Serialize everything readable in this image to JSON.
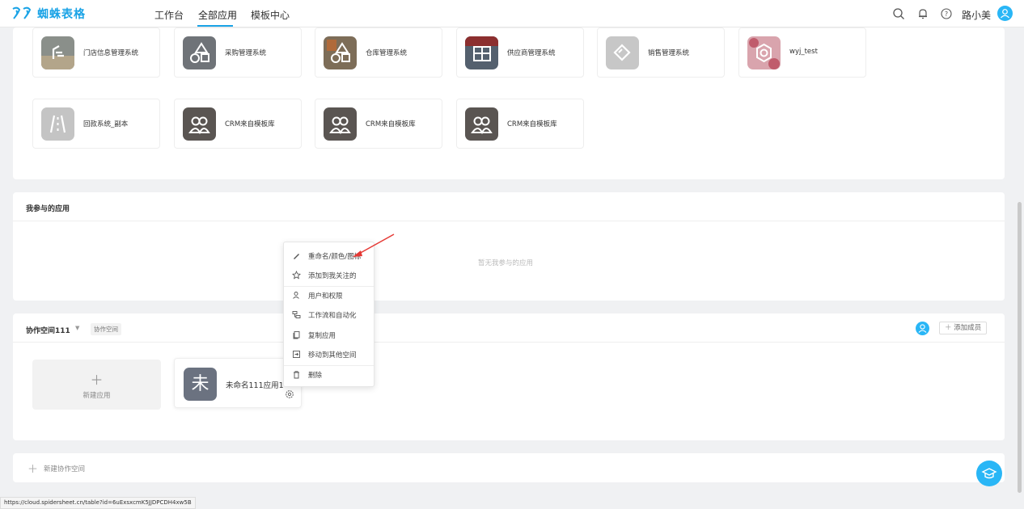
{
  "brand": {
    "name": "蜘蛛表格",
    "color": "#1aa3e6"
  },
  "nav": [
    {
      "label": "工作台"
    },
    {
      "label": "全部应用",
      "active": true
    },
    {
      "label": "模板中心"
    }
  ],
  "topbar_icons": [
    "search-icon",
    "bell-icon",
    "help-icon",
    "user-avatar-icon"
  ],
  "user": {
    "name": "路小美"
  },
  "apps_top": [
    {
      "name": "门店信息管理系统",
      "icon": "store-photo-icon"
    },
    {
      "name": "采购管理系统",
      "icon": "shapes-photo-icon"
    },
    {
      "name": "仓库管理系统",
      "icon": "shapes-photo-icon"
    },
    {
      "name": "供应商管理系统",
      "icon": "grid-photo-icon"
    },
    {
      "name": "销售管理系统",
      "icon": "handshake-icon"
    },
    {
      "name": "wyj_test",
      "icon": "hexagon-photo-icon"
    },
    {
      "name": "回款系统_副本",
      "icon": "road-icon"
    },
    {
      "name": "CRM来自模板库",
      "icon": "people-photo-icon"
    },
    {
      "name": "CRM来自模板库",
      "icon": "people-photo-icon"
    },
    {
      "name": "CRM来自模板库",
      "icon": "people-photo-icon"
    }
  ],
  "participated": {
    "title": "我参与的应用",
    "empty": "暂无我参与的应用"
  },
  "workspace": {
    "name": "协作空间111",
    "tag": "协作空间",
    "add_member": "添加成员",
    "new_app": "新建应用",
    "owned_app": {
      "initial": "未",
      "name": "未命名111应用1"
    }
  },
  "context_menu": [
    {
      "label": "重命名/颜色/图标",
      "icon": "pencil-icon"
    },
    {
      "label": "添加到我关注的",
      "icon": "star-icon"
    },
    {
      "label": "用户和权限",
      "icon": "user-permission-icon"
    },
    {
      "label": "工作流和自动化",
      "icon": "workflow-icon"
    },
    {
      "label": "复制应用",
      "icon": "copy-icon"
    },
    {
      "label": "移动到其他空间",
      "icon": "move-icon"
    },
    {
      "label": "删除",
      "icon": "trash-icon"
    }
  ],
  "new_workspace": "新建协作空间",
  "status_url": "https://cloud.spidersheet.cn/table?id=6uExsxcmK5JJDPCDH4xw5B",
  "accent_color": "#29b6f6"
}
